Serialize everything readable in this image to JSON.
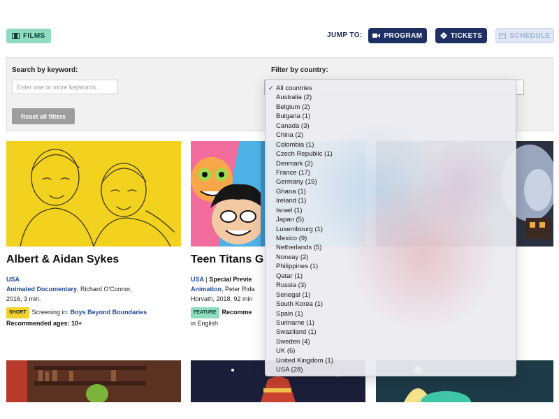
{
  "header": {
    "films_label": "FILMS",
    "jump_to": "JUMP TO:",
    "nav": [
      {
        "label": "PROGRAM",
        "icon": "video-camera-icon"
      },
      {
        "label": "TICKETS",
        "icon": "ticket-icon"
      },
      {
        "label": "SCHEDULE",
        "icon": "calendar-icon",
        "state": "disabled"
      }
    ]
  },
  "filters": {
    "keyword_label": "Search by keyword:",
    "keyword_placeholder": "Enter one or more keywords...",
    "country_label": "Filter by country:",
    "reset_label": "Reset all filters"
  },
  "country_options": [
    "All countries",
    "Australia (2)",
    "Belgium (2)",
    "Bulgaria (1)",
    "Canada (3)",
    "China (2)",
    "Colombia (1)",
    "Czech Republic (1)",
    "Denmark (2)",
    "France (17)",
    "Germany (15)",
    "Ghana (1)",
    "Ireland (1)",
    "Israel (1)",
    "Japan (5)",
    "Luxembourg (1)",
    "Mexico (9)",
    "Netherlands (5)",
    "Norway (2)",
    "Philippines (1)",
    "Qatar (1)",
    "Russia (3)",
    "Senegal (1)",
    "South Korea (1)",
    "Spain (1)",
    "Suriname (1)",
    "Swaziland (1)",
    "Sweden (4)",
    "UK (6)",
    "United Kingdom (1)",
    "USA (28)"
  ],
  "selected_country_index": 0,
  "films": [
    {
      "title": "Albert & Aidan Sykes",
      "country": "USA",
      "genre": "Animated Documentary",
      "credits": ", Richard O'Connor,",
      "details": "2016, 3 min.",
      "tag": "SHORT",
      "screening_label": "Screening in:",
      "program": "Boys Beyond Boundaries",
      "ages_label": "Recommended ages:",
      "ages": "10+"
    },
    {
      "title": "Teen Titans G",
      "country": "USA",
      "separator": "|",
      "special": "Special Previe",
      "genre": "Animation",
      "credits": ", Peter Rida",
      "details": "Horvath, 2018, 92 min",
      "tag": "FEATURE",
      "ages_label": "Recomme",
      "language": "in English"
    }
  ],
  "colors": {
    "navy": "#1e2f63",
    "mint": "#8fdcc0",
    "yellow": "#f2d11f",
    "link_blue": "#1e4a9a"
  }
}
